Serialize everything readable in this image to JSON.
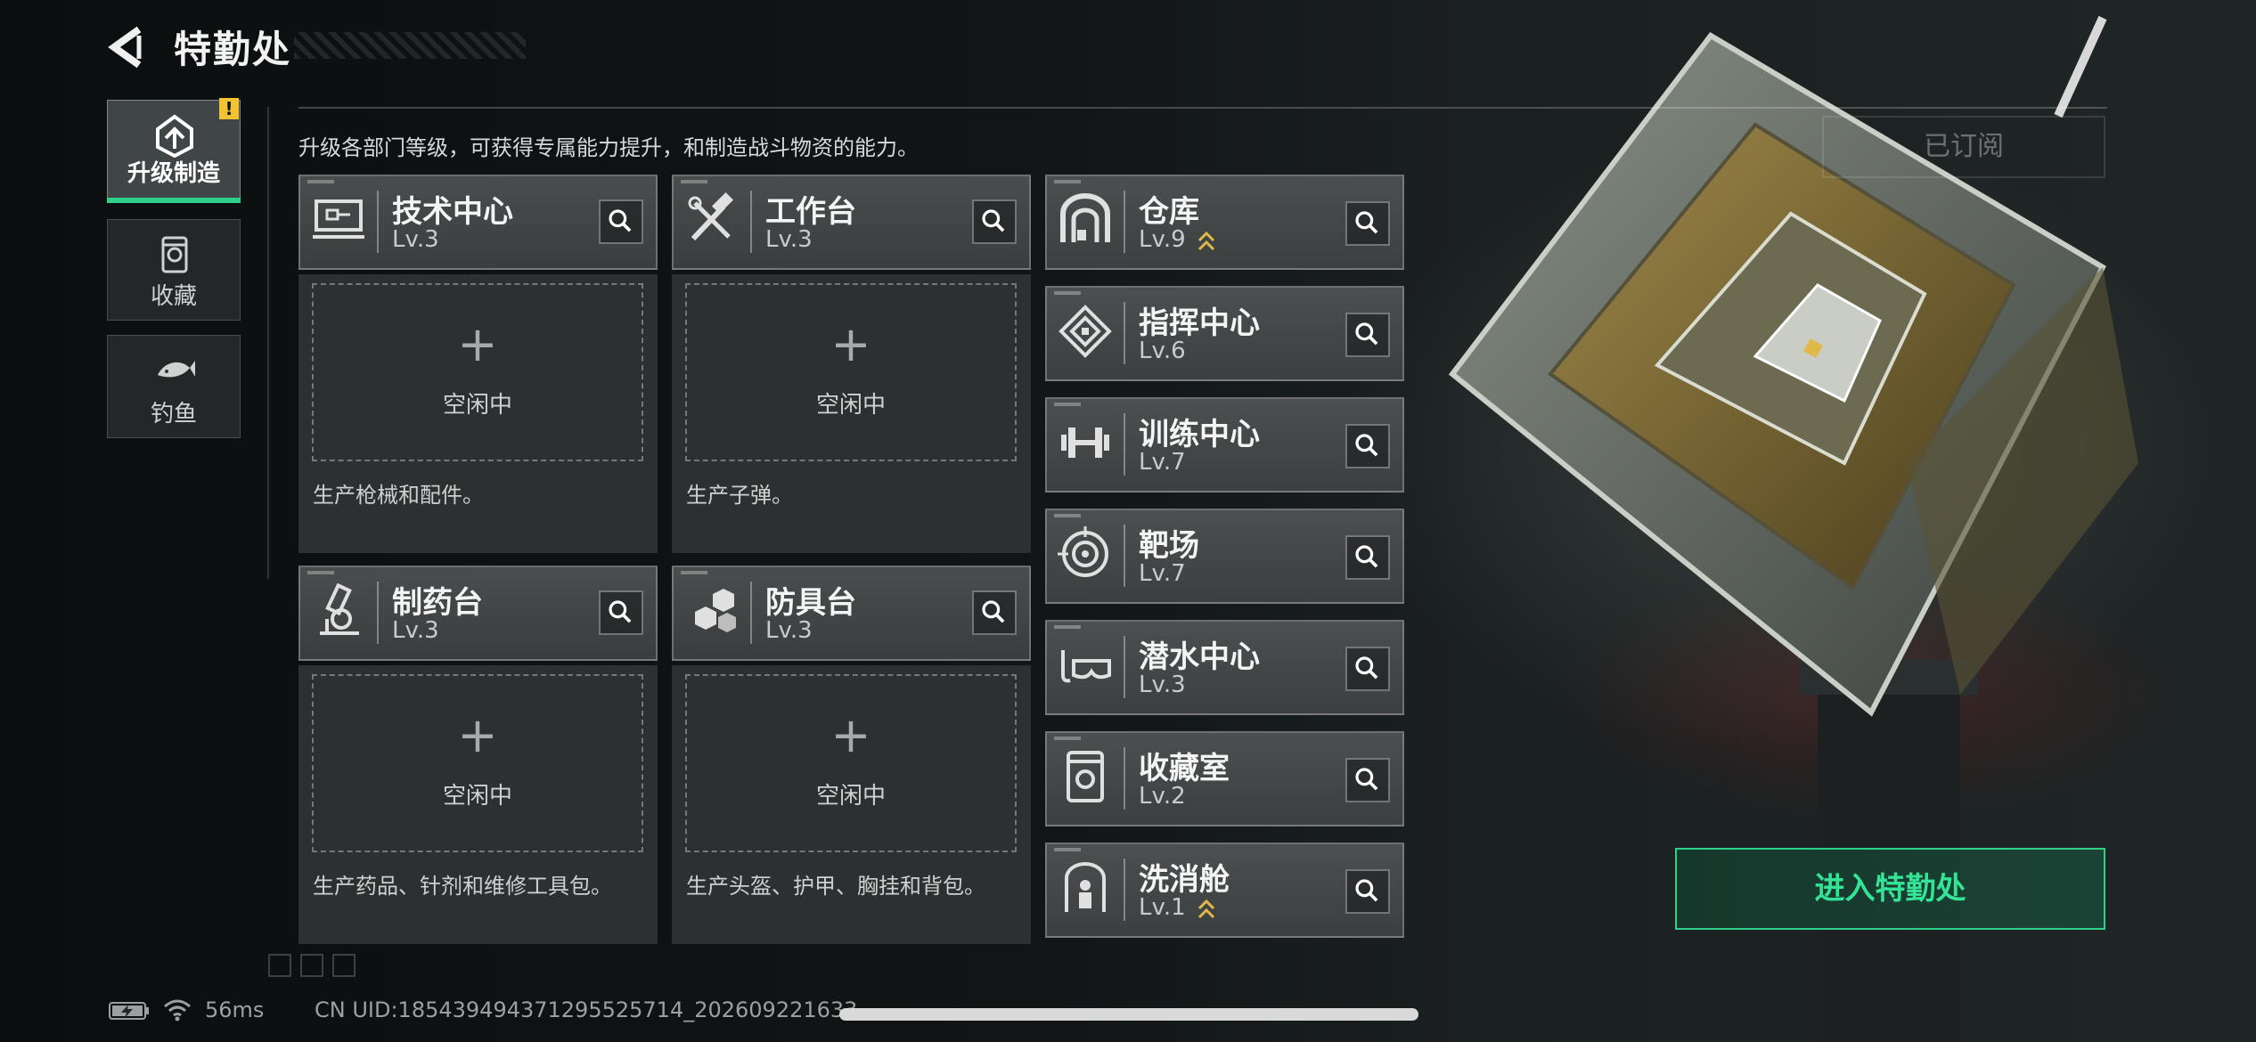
{
  "header": {
    "title": "特勤处"
  },
  "sidebar": {
    "tabs": [
      {
        "label": "升级制造",
        "icon": "upgrade-icon",
        "active": true,
        "alert": "!"
      },
      {
        "label": "收藏",
        "icon": "collection-icon",
        "active": false
      },
      {
        "label": "钓鱼",
        "icon": "fish-icon",
        "active": false
      }
    ]
  },
  "main": {
    "description": "升级各部门等级，可获得专属能力提升，和制造战斗物资的能力。",
    "subscribed_label": "已订阅",
    "enter_label": "进入特勤处",
    "production_cards": [
      {
        "name": "技术中心",
        "level": "Lv.3",
        "slot_label": "空闲中",
        "plus": "+",
        "desc": "生产枪械和配件。",
        "icon": "tech-center-icon"
      },
      {
        "name": "工作台",
        "level": "Lv.3",
        "slot_label": "空闲中",
        "plus": "+",
        "desc": "生产子弹。",
        "icon": "workbench-icon"
      },
      {
        "name": "制药台",
        "level": "Lv.3",
        "slot_label": "空闲中",
        "plus": "+",
        "desc": "生产药品、针剂和维修工具包。",
        "icon": "pharmacy-icon"
      },
      {
        "name": "防具台",
        "level": "Lv.3",
        "slot_label": "空闲中",
        "plus": "+",
        "desc": "生产头盔、护甲、胸挂和背包。",
        "icon": "armor-bench-icon"
      }
    ],
    "facilities": [
      {
        "name": "仓库",
        "level": "Lv.9",
        "upgradable": true,
        "icon": "warehouse-icon"
      },
      {
        "name": "指挥中心",
        "level": "Lv.6",
        "upgradable": false,
        "icon": "command-center-icon"
      },
      {
        "name": "训练中心",
        "level": "Lv.7",
        "upgradable": false,
        "icon": "training-center-icon"
      },
      {
        "name": "靶场",
        "level": "Lv.7",
        "upgradable": false,
        "icon": "shooting-range-icon"
      },
      {
        "name": "潜水中心",
        "level": "Lv.3",
        "upgradable": false,
        "icon": "diving-center-icon"
      },
      {
        "name": "收藏室",
        "level": "Lv.2",
        "upgradable": false,
        "icon": "collection-room-icon"
      },
      {
        "name": "洗消舱",
        "level": "Lv.1",
        "upgradable": true,
        "icon": "decontamination-icon"
      }
    ]
  },
  "status_bar": {
    "ping": "56ms",
    "uid": "CN UID:18543949437129552571​4_202609221633"
  },
  "colors": {
    "accent": "#2fd08a",
    "alert": "#f2c230",
    "upgrade_arrow": "#e0b84a"
  }
}
